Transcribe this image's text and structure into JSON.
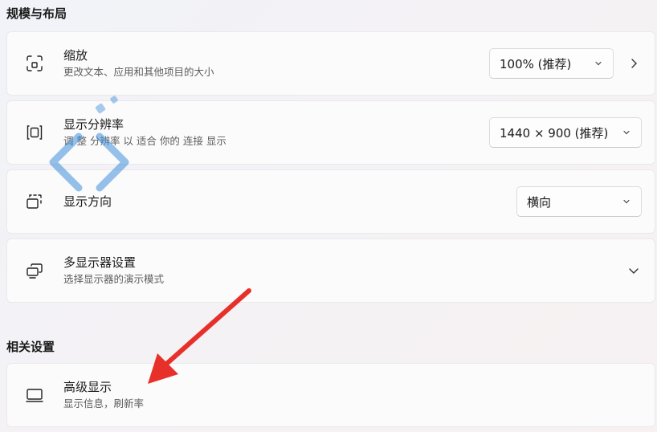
{
  "sections": {
    "layout_header": "规模与布局",
    "related_header": "相关设置"
  },
  "scale": {
    "title": "缩放",
    "subtitle": "更改文本、应用和其他项目的大小",
    "value": "100% (推荐)",
    "icon": "zoom-frame-icon"
  },
  "resolution": {
    "title": "显示分辨率",
    "subtitle": "调 整 分辨率 以 适合 你的 连接 显示",
    "value": "1440 × 900 (推荐)",
    "icon": "resolution-frame-icon"
  },
  "orientation": {
    "title": "显示方向",
    "value": "横向",
    "icon": "orientation-icon"
  },
  "multi_display": {
    "title": "多显示器设置",
    "subtitle": "选择显示器的演示模式",
    "icon": "multi-monitor-icon"
  },
  "advanced_display": {
    "title": "高级显示",
    "subtitle": "显示信息，刷新率",
    "icon": "monitor-icon"
  },
  "colors": {
    "annotation_arrow": "#e8302a",
    "watermark": "#3f8fd8"
  }
}
